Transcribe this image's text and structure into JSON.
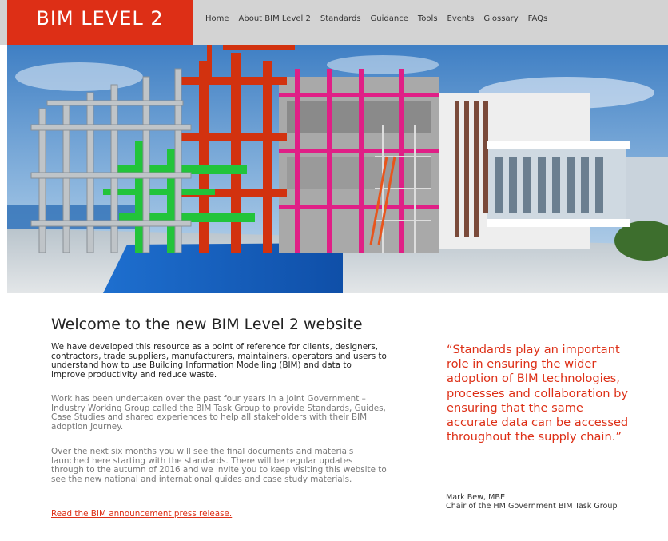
{
  "header": {
    "logo_text": "BIM LEVEL 2",
    "nav": [
      {
        "label": "Home"
      },
      {
        "label": "About BIM Level 2"
      },
      {
        "label": "Standards"
      },
      {
        "label": "Guidance"
      },
      {
        "label": "Tools"
      },
      {
        "label": "Events"
      },
      {
        "label": "Glossary"
      },
      {
        "label": "FAQs"
      }
    ]
  },
  "main": {
    "title": "Welcome to the new BIM Level 2 website",
    "paragraphs": [
      "We have developed this resource as a point of reference for clients, designers, contractors, trade suppliers, manufacturers, maintainers, operators and users to understand how to use Building Information Modelling (BIM) and data to improve productivity and reduce waste.",
      "Work has been undertaken over the past four years in a joint Government – Industry Working Group called the BIM Task Group to provide Standards, Guides, Case Studies and shared experiences to help all stakeholders with their BIM adoption Journey.",
      "Over the next six months you will see the final documents and materials launched here starting with the standards. There will be regular updates through to the autumn of 2016 and we invite you to keep visiting this website to see the new national and international guides and case study materials."
    ],
    "press_link": "Read the BIM announcement press release."
  },
  "quote": {
    "text": "“Standards play an important role in ensuring the wider adoption of BIM technologies, processes and collaboration by ensuring that the same accurate data can be accessed throughout the supply chain.”",
    "author": "Mark Bew, MBE",
    "role": "Chair of the HM Government BIM Task Group"
  },
  "colors": {
    "brand_red": "#dd2f16",
    "nav_bar": "#d3d3d3"
  }
}
